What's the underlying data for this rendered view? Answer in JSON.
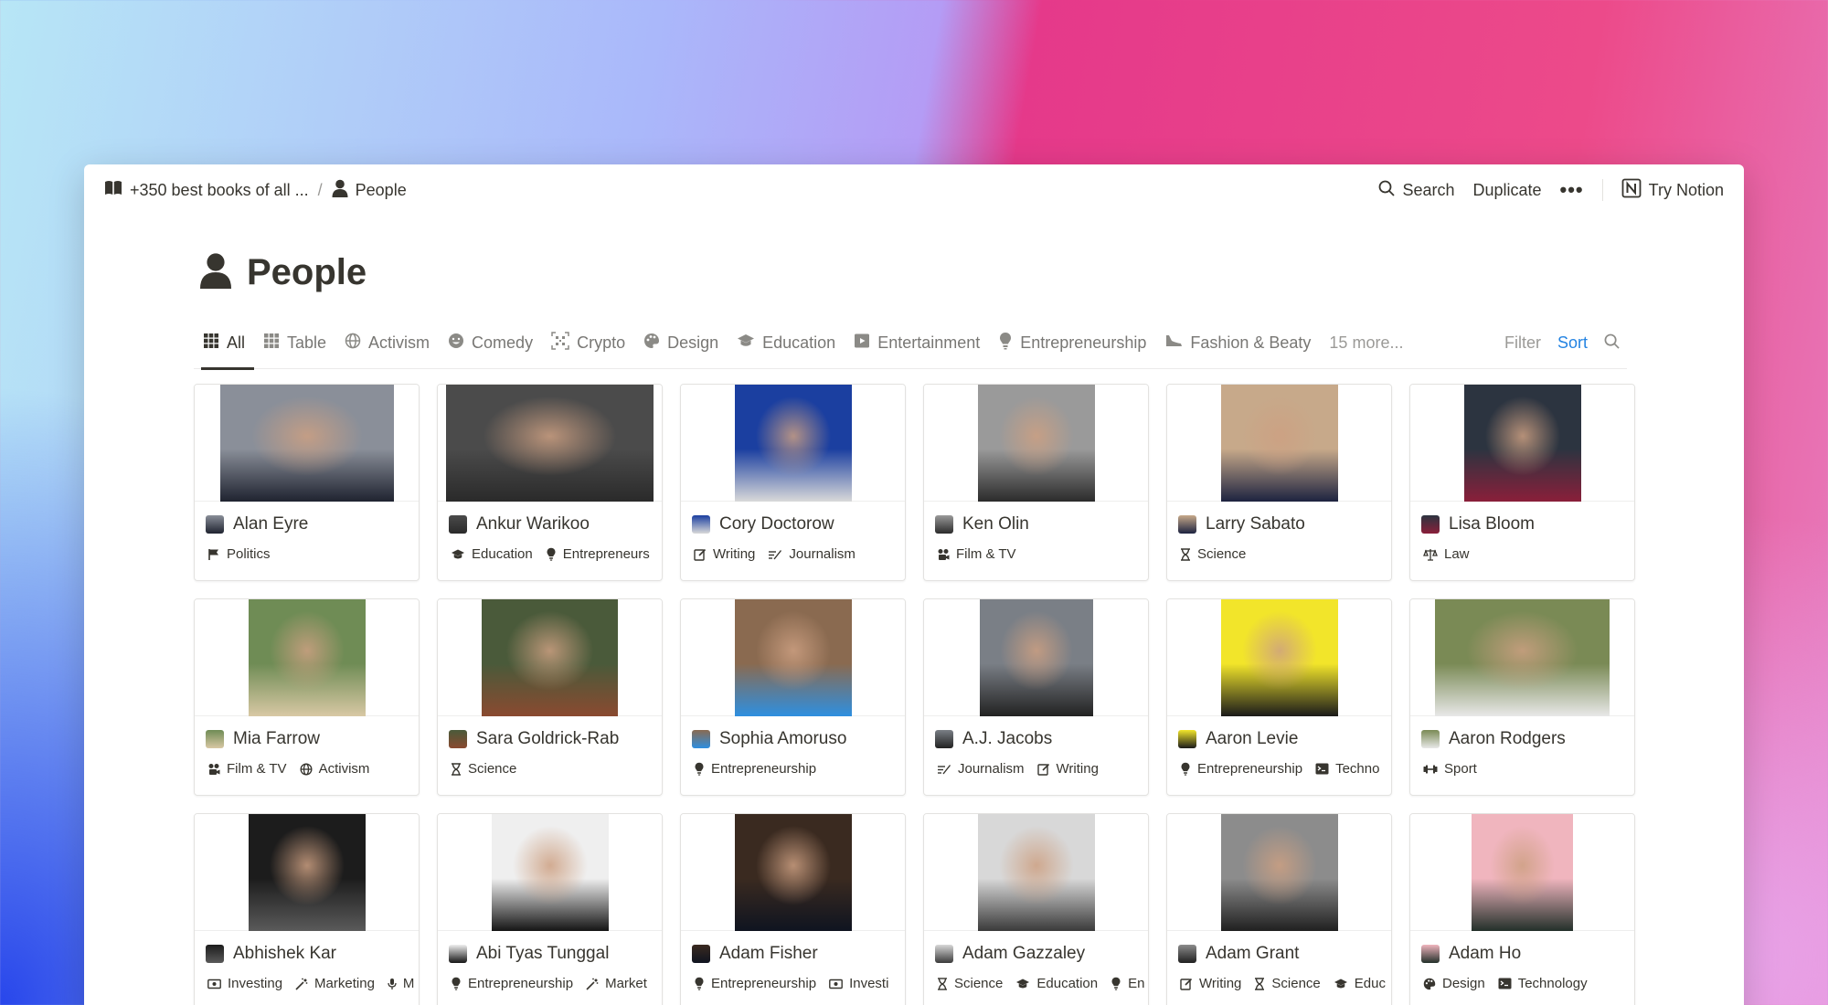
{
  "topbar": {
    "breadcrumb_parent": "+350 best books of all ...",
    "breadcrumb_separator": "/",
    "breadcrumb_current": "People",
    "search_label": "Search",
    "duplicate_label": "Duplicate",
    "more_label": "•••",
    "try_notion_label": "Try Notion"
  },
  "page": {
    "title": "People",
    "icon": "person-icon"
  },
  "tabs": [
    {
      "label": "All",
      "icon": "grid-icon",
      "active": true
    },
    {
      "label": "Table",
      "icon": "table-icon"
    },
    {
      "label": "Activism",
      "icon": "globe-icon"
    },
    {
      "label": "Comedy",
      "icon": "smile-icon"
    },
    {
      "label": "Crypto",
      "icon": "qr-icon"
    },
    {
      "label": "Design",
      "icon": "palette-icon"
    },
    {
      "label": "Education",
      "icon": "graduation-cap-icon"
    },
    {
      "label": "Entertainment",
      "icon": "film-icon"
    },
    {
      "label": "Entrepreneurship",
      "icon": "lightbulb-icon"
    },
    {
      "label": "Fashion & Beaty",
      "icon": "shoe-icon"
    }
  ],
  "more_tabs": "15 more...",
  "tools": {
    "filter": "Filter",
    "sort": "Sort"
  },
  "accent_color": "#2383e2",
  "cards": [
    {
      "name": "Alan Eyre",
      "tags": [
        "Politics"
      ],
      "colors": [
        "#8a8f99",
        "#1f2330"
      ]
    },
    {
      "name": "Ankur Warikoo",
      "tags": [
        "Education",
        "Entrepreneurs"
      ],
      "colors": [
        "#4b4b4b",
        "#2a2a2a"
      ]
    },
    {
      "name": "Cory Doctorow",
      "tags": [
        "Writing",
        "Journalism"
      ],
      "colors": [
        "#1b3fa0",
        "#d9d9d9"
      ]
    },
    {
      "name": "Ken Olin",
      "tags": [
        "Film & TV"
      ],
      "colors": [
        "#9a9a9a",
        "#2b2b2b"
      ]
    },
    {
      "name": "Larry Sabato",
      "tags": [
        "Science"
      ],
      "colors": [
        "#c7a98a",
        "#1d2340"
      ]
    },
    {
      "name": "Lisa Bloom",
      "tags": [
        "Law"
      ],
      "colors": [
        "#2c3440",
        "#8a1f3a"
      ]
    },
    {
      "name": "Mia Farrow",
      "tags": [
        "Film & TV",
        "Activism"
      ],
      "colors": [
        "#6f8c55",
        "#d8c8a4"
      ]
    },
    {
      "name": "Sara Goldrick-Rab",
      "tags": [
        "Science"
      ],
      "colors": [
        "#4a5a3a",
        "#8a4a30"
      ]
    },
    {
      "name": "Sophia Amoruso",
      "tags": [
        "Entrepreneurship"
      ],
      "colors": [
        "#8a6a50",
        "#2e8fe0"
      ]
    },
    {
      "name": "A.J. Jacobs",
      "tags": [
        "Journalism",
        "Writing"
      ],
      "colors": [
        "#7a7f86",
        "#222222"
      ]
    },
    {
      "name": "Aaron Levie",
      "tags": [
        "Entrepreneurship",
        "Techno"
      ],
      "colors": [
        "#f2e52a",
        "#1a1a1a"
      ]
    },
    {
      "name": "Aaron Rodgers",
      "tags": [
        "Sport"
      ],
      "colors": [
        "#7a8a55",
        "#e8e8e8"
      ]
    },
    {
      "name": "Abhishek Kar",
      "tags": [
        "Investing",
        "Marketing",
        "M"
      ],
      "colors": [
        "#1c1c1c",
        "#5a5a5a"
      ]
    },
    {
      "name": "Abi Tyas Tunggal",
      "tags": [
        "Entrepreneurship",
        "Market"
      ],
      "colors": [
        "#efefef",
        "#151515"
      ]
    },
    {
      "name": "Adam Fisher",
      "tags": [
        "Entrepreneurship",
        "Investi"
      ],
      "colors": [
        "#3a2a20",
        "#0f1420"
      ]
    },
    {
      "name": "Adam Gazzaley",
      "tags": [
        "Science",
        "Education",
        "En"
      ],
      "colors": [
        "#d8d8d8",
        "#3a3a3a"
      ]
    },
    {
      "name": "Adam Grant",
      "tags": [
        "Writing",
        "Science",
        "Educ"
      ],
      "colors": [
        "#8c8c8c",
        "#202020"
      ]
    },
    {
      "name": "Adam Ho",
      "tags": [
        "Design",
        "Technology"
      ],
      "colors": [
        "#f0b5be",
        "#23302a"
      ]
    }
  ]
}
